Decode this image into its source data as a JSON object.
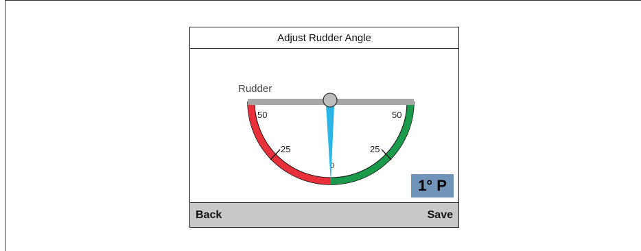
{
  "screen": {
    "title": "Adjust Rudder Angle"
  },
  "gauge": {
    "label": "Rudder",
    "ticks": {
      "port_50": "50",
      "port_25": "25",
      "center": "0",
      "stbd_25": "25",
      "stbd_50": "50"
    },
    "rudder_angle_deg": 1,
    "rudder_side": "P",
    "colors": {
      "port": "#e8303a",
      "starboard": "#1a9a4a",
      "pointer": "#29b6e6",
      "bar": "#a6a6a6",
      "readout_bg": "#6f94b8"
    }
  },
  "readout": {
    "value": "1° P"
  },
  "softkeys": {
    "back_label": "Back",
    "save_label": "Save"
  }
}
